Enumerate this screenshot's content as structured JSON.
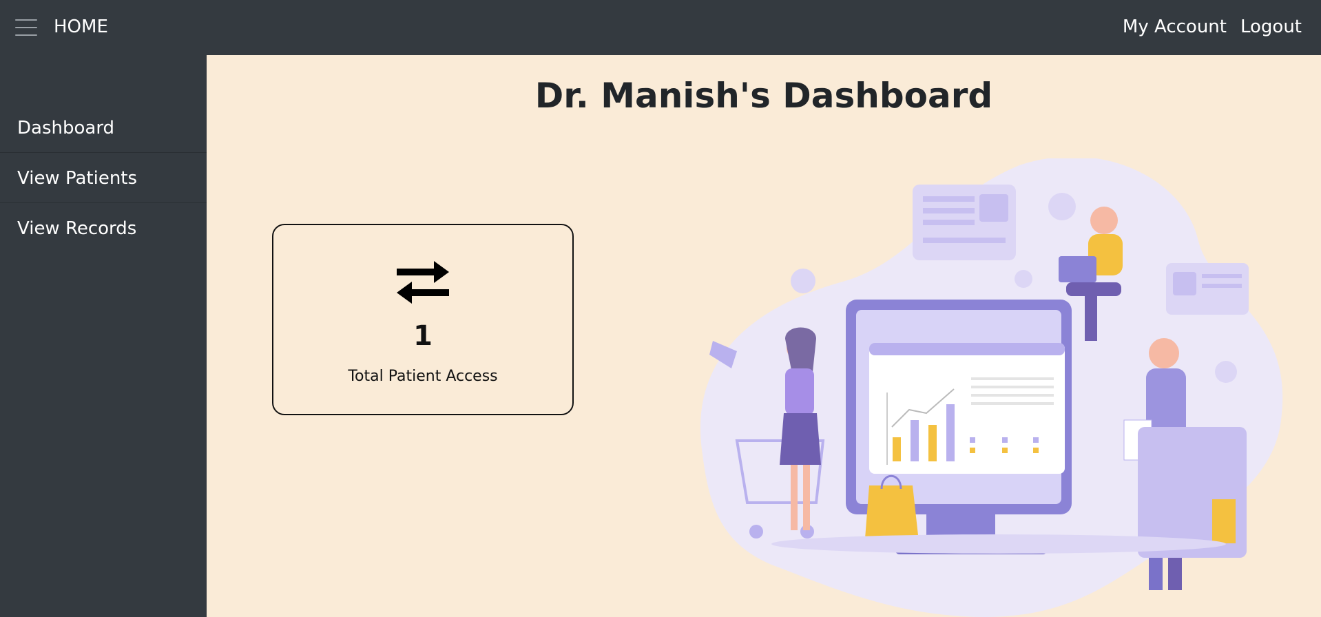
{
  "topbar": {
    "home_label": "HOME",
    "account_label": "My Account",
    "logout_label": "Logout"
  },
  "sidebar": {
    "items": [
      {
        "label": "Dashboard"
      },
      {
        "label": "View Patients"
      },
      {
        "label": "View Records"
      }
    ]
  },
  "main": {
    "title": "Dr. Manish's Dashboard",
    "card": {
      "icon": "swap-arrows-icon",
      "value": "1",
      "label": "Total Patient Access"
    },
    "illustration": "dashboard-marketing-illustration"
  },
  "colors": {
    "topbar": "#343a40",
    "background": "#faebd7",
    "accent_purple": "#8b83d6",
    "accent_yellow": "#f4c140"
  }
}
